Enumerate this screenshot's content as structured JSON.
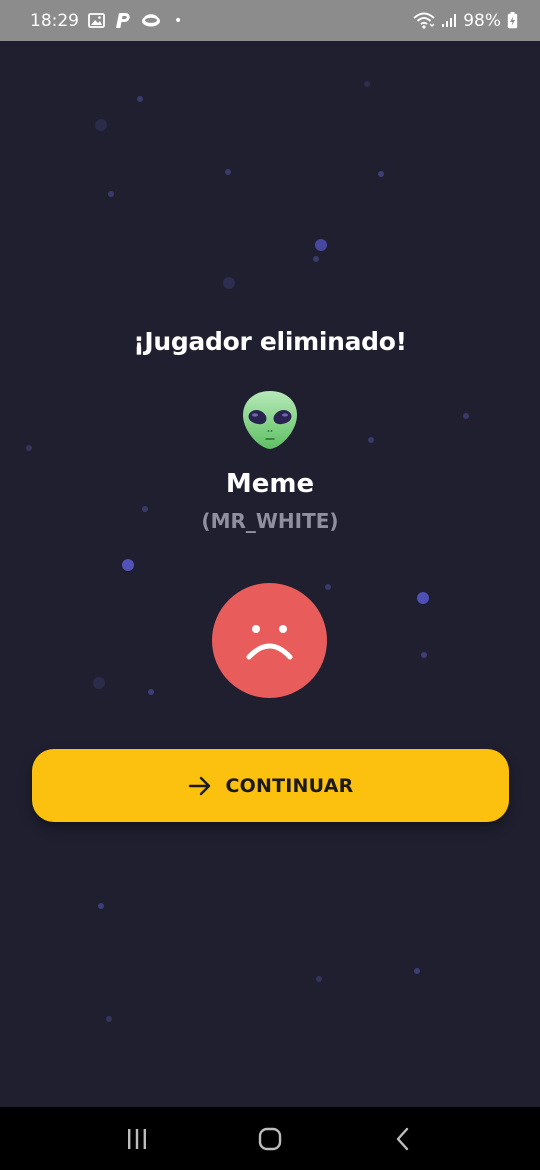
{
  "status_bar": {
    "time": "18:29",
    "separator": "•",
    "battery": "98%"
  },
  "screen": {
    "title": "¡Jugador eliminado!",
    "player": {
      "avatar_icon": "alien-icon",
      "name": "Meme",
      "role": "(MR_WHITE)"
    },
    "result_icon": "sad-face-icon",
    "continue_button": {
      "icon": "arrow-right-icon",
      "label": "CONTINUAR"
    }
  },
  "nav_bar": {
    "recent_icon": "recent-apps-icon",
    "home_icon": "home-icon",
    "back_icon": "back-icon"
  },
  "colors": {
    "background": "#1f1f30",
    "accent": "#fcc10f",
    "sad_face": "#e85c5c",
    "role_text": "#8f8f9f"
  }
}
